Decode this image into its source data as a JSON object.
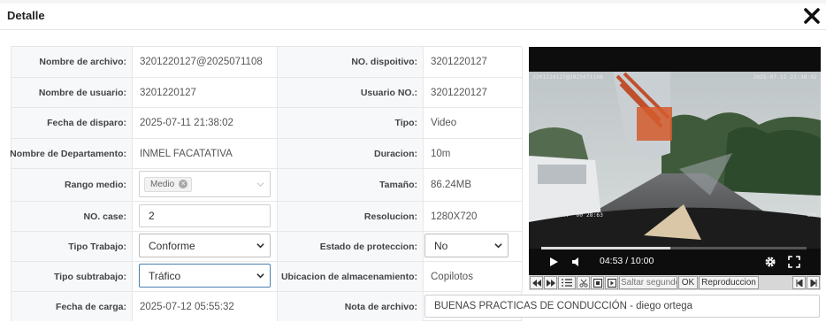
{
  "dialog": {
    "title": "Detalle",
    "close_icon": "close-icon"
  },
  "fields": {
    "nombre_archivo": {
      "label": "Nombre de archivo:",
      "value": "3201220127@2025071108"
    },
    "nombre_usuario": {
      "label": "Nombre de usuario:",
      "value": "3201220127"
    },
    "fecha_disparo": {
      "label": "Fecha de disparo:",
      "value": "2025-07-11 21:38:02"
    },
    "departamento": {
      "label": "Nombre de Departamento:",
      "value": "INMEL FACATATIVA"
    },
    "rango_medio": {
      "label": "Rango medio:",
      "tag": "Medio"
    },
    "no_case": {
      "label": "NO. case:",
      "value": "2"
    },
    "tipo_trabajo": {
      "label": "Tipo Trabajo:",
      "value": "Conforme"
    },
    "tipo_subtrabajo": {
      "label": "Tipo subtrabajo:",
      "value": "Tráfico"
    },
    "fecha_carga": {
      "label": "Fecha de carga:",
      "value": "2025-07-12 05:55:32"
    },
    "no_dispositivo": {
      "label": "NO. dispoitivo:",
      "value": "3201220127"
    },
    "usuario_no": {
      "label": "Usuario NO.:",
      "value": "3201220127"
    },
    "tipo": {
      "label": "Tipo:",
      "value": "Video"
    },
    "duracion": {
      "label": "Duracion:",
      "value": "10m"
    },
    "tamano": {
      "label": "Tamaño:",
      "value": "86.24MB"
    },
    "resolucion": {
      "label": "Resolucion:",
      "value": "1280X720"
    },
    "estado_proteccion": {
      "label": "Estado de proteccion:",
      "value": "No"
    },
    "ubicacion": {
      "label": "Ubicacion de almacenamiento:",
      "value": "Copilotos"
    },
    "nota_archivo": {
      "label": "Nota de archivo:",
      "value": "BUENAS PRACTICAS DE CONDUCCIÓN - diego ortega"
    }
  },
  "video": {
    "time": "04:53 / 10:00",
    "progress": 0.488,
    "osd_top_left": "3201220127@2025071108",
    "osd_top_right": "2025-07-11 21:38:02",
    "osd_bottom_left": "N4 KM/H 4.7° 00 28:63",
    "osd_bottom_right": "CH1"
  },
  "toolbar": {
    "seek_placeholder": "Saltar segundos",
    "ok_label": "OK",
    "playback_label": "Reproduccion"
  }
}
